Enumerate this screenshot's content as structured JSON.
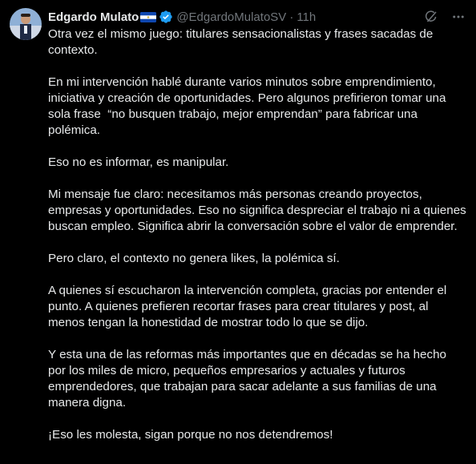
{
  "colors": {
    "background": "#000000",
    "text_primary": "#e7e9ea",
    "text_secondary": "#71767b",
    "verified_blue": "#1d9bf0"
  },
  "author": {
    "display_name": "Edgardo Mulato",
    "handle": "@EdgardoMulatoSV",
    "separator": "·",
    "time": "11h",
    "flag_icon": "el-salvador-flag-icon",
    "verified_icon": "verified-badge-icon"
  },
  "actions": {
    "grok_icon": "grok-icon",
    "more_icon": "more-icon"
  },
  "post": {
    "paragraphs": [
      "Otra vez el mismo juego: titulares sensacionalistas y frases sacadas de contexto.",
      "En mi intervención hablé durante varios minutos sobre emprendimiento, iniciativa y creación de oportunidades. Pero algunos prefirieron tomar una sola frase  “no busquen trabajo, mejor emprendan” para fabricar una polémica.",
      "Eso no es informar, es manipular.",
      "Mi mensaje fue claro: necesitamos más personas creando proyectos, empresas y oportunidades. Eso no significa despreciar el trabajo ni a quienes buscan empleo. Significa abrir la conversación sobre el valor de emprender.",
      "Pero claro, el contexto no genera likes, la polémica sí.",
      "A quienes sí escucharon la intervención completa, gracias por entender el punto. A quienes prefieren recortar frases para crear titulares y post, al menos tengan la honestidad de mostrar todo lo que se dijo.",
      "Y esta una de las reformas más importantes que en décadas se ha hecho por los miles de micro, pequeños empresarios y actuales y futuros emprendedores, que trabajan para sacar adelante a sus familias de una manera digna.",
      "¡Eso les molesta, sigan porque no nos detendremos!"
    ]
  }
}
